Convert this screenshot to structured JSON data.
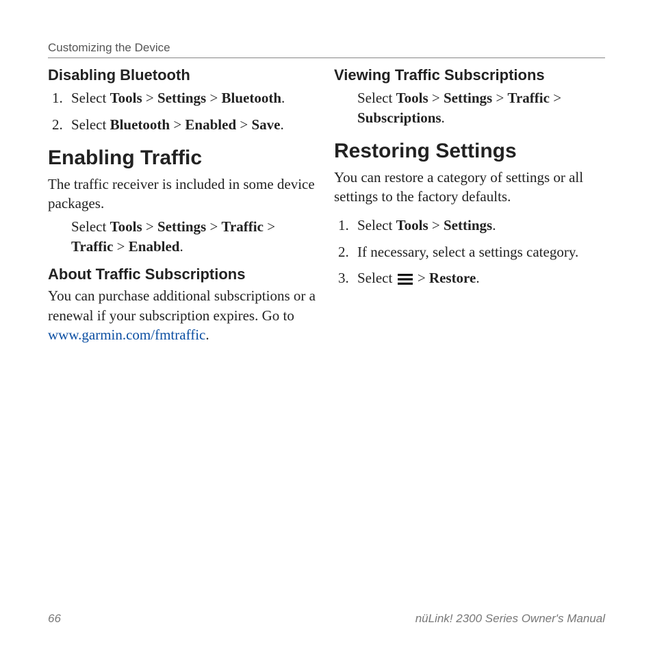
{
  "breadcrumb": "Customizing the Device",
  "left": {
    "h3a": "Disabling Bluetooth",
    "ol1": {
      "n1": "1.",
      "t1a": "Select ",
      "t1b": "Tools",
      "t1c": " > ",
      "t1d": "Settings",
      "t1e": " > ",
      "t1f": "Bluetooth",
      "t1g": ".",
      "n2": "2.",
      "t2a": "Select ",
      "t2b": "Bluetooth",
      "t2c": " > ",
      "t2d": "Enabled",
      "t2e": " > ",
      "t2f": "Save",
      "t2g": "."
    },
    "h2a": "Enabling Traffic",
    "p1": "The traffic receiver is included in some device packages.",
    "p2": {
      "a": "Select ",
      "b": "Tools",
      "c": " > ",
      "d": "Settings",
      "e": " > ",
      "f": "Traffic",
      "g": " > ",
      "h": "Traffic",
      "i": " > ",
      "j": "Enabled",
      "k": "."
    },
    "h3b": "About Traffic Subscriptions",
    "p3a": "You can purchase additional subscriptions or a renewal if your subscription expires. Go to ",
    "p3link": "www.garmin.com/fmtraffic",
    "p3b": "."
  },
  "right": {
    "h3a": "Viewing Traffic Subscriptions",
    "p1": {
      "a": "Select ",
      "b": "Tools",
      "c": " > ",
      "d": "Settings",
      "e": " > ",
      "f": "Traffic",
      "g": " > ",
      "h": "Subscriptions",
      "i": "."
    },
    "h2a": "Restoring Settings",
    "p2": "You can restore a category of settings or all settings to the factory defaults.",
    "ol1": {
      "n1": "1.",
      "t1a": "Select ",
      "t1b": "Tools",
      "t1c": " > ",
      "t1d": "Settings",
      "t1e": ".",
      "n2": "2.",
      "t2": "If necessary, select a settings category.",
      "n3": "3.",
      "t3a": "Select ",
      "t3b": " > ",
      "t3c": "Restore",
      "t3d": "."
    }
  },
  "footer": {
    "page": "66",
    "title": "nüLink! 2300 Series Owner's Manual"
  }
}
